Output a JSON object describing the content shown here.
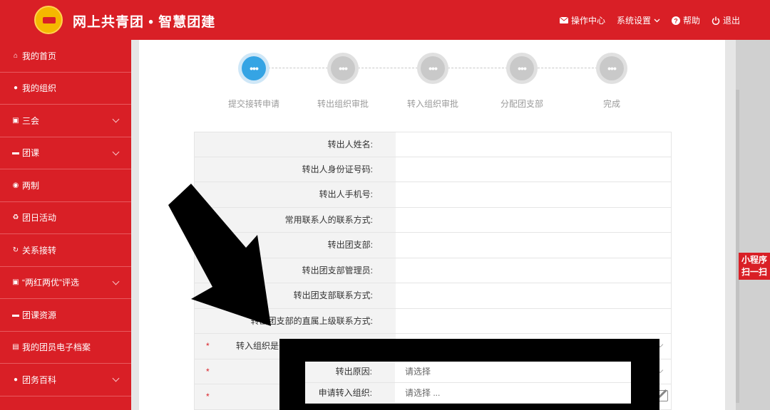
{
  "header": {
    "title": "网上共青团 • 智慧团建",
    "actions": [
      {
        "icon": "envelope-icon",
        "label": "操作中心"
      },
      {
        "icon": "chevron-down-icon",
        "label": "系统设置"
      },
      {
        "icon": "help-icon",
        "label": "帮助"
      },
      {
        "icon": "power-icon",
        "label": "退出"
      }
    ]
  },
  "sidebar": {
    "items": [
      {
        "icon": "home-icon",
        "label": "我的首页",
        "has_submenu": false
      },
      {
        "icon": "users-icon",
        "label": "我的组织",
        "has_submenu": false
      },
      {
        "icon": "edit-icon",
        "label": "三会",
        "has_submenu": true
      },
      {
        "icon": "folder-icon",
        "label": "团课",
        "has_submenu": true
      },
      {
        "icon": "circle-dot-icon",
        "label": "两制",
        "has_submenu": false
      },
      {
        "icon": "recycle-icon",
        "label": "团日活动",
        "has_submenu": false
      },
      {
        "icon": "refresh-icon",
        "label": "关系接转",
        "has_submenu": false
      },
      {
        "icon": "edit-icon",
        "label": "“两红两优”评选",
        "has_submenu": true
      },
      {
        "icon": "folder-icon",
        "label": "团课资源",
        "has_submenu": false
      },
      {
        "icon": "document-icon",
        "label": "我的团员电子档案",
        "has_submenu": false
      },
      {
        "icon": "users-icon",
        "label": "团务百科",
        "has_submenu": true
      }
    ]
  },
  "steps": [
    {
      "label": "提交接转申请",
      "active": true
    },
    {
      "label": "转出组织审批",
      "active": false
    },
    {
      "label": "转入组织审批",
      "active": false
    },
    {
      "label": "分配团支部",
      "active": false
    },
    {
      "label": "完成",
      "active": false
    }
  ],
  "form": {
    "rows": [
      {
        "label": "转出人姓名:",
        "value": "",
        "required": false
      },
      {
        "label": "转出人身份证号码:",
        "value": "",
        "required": false
      },
      {
        "label": "转出人手机号:",
        "value": "",
        "required": false
      },
      {
        "label": "常用联系人的联系方式:",
        "value": "",
        "required": false
      },
      {
        "label": "转出团支部:",
        "value": "",
        "required": false
      },
      {
        "label": "转出团支部管理员:",
        "value": "",
        "required": false
      },
      {
        "label": "转出团支部联系方式:",
        "value": "",
        "required": false
      },
      {
        "label": "转出团支部的直属上级联系方式:",
        "value": "",
        "required": false
      },
      {
        "label": "转入组织是否",
        "value": "",
        "required": true
      },
      {
        "label": "",
        "value": "",
        "required": true
      },
      {
        "label": "",
        "value": "",
        "required": true
      }
    ]
  },
  "popup": {
    "rows": [
      {
        "label": "转出原因:",
        "value": "请选择"
      },
      {
        "label": "申请转入组织:",
        "value": "请选择 ..."
      }
    ]
  },
  "mini_program": {
    "line1": "小程序",
    "line2": "扫一扫"
  },
  "colors": {
    "brand_red": "#d91f26",
    "step_active": "#35a4e4",
    "step_inactive": "#c9c9c9"
  }
}
